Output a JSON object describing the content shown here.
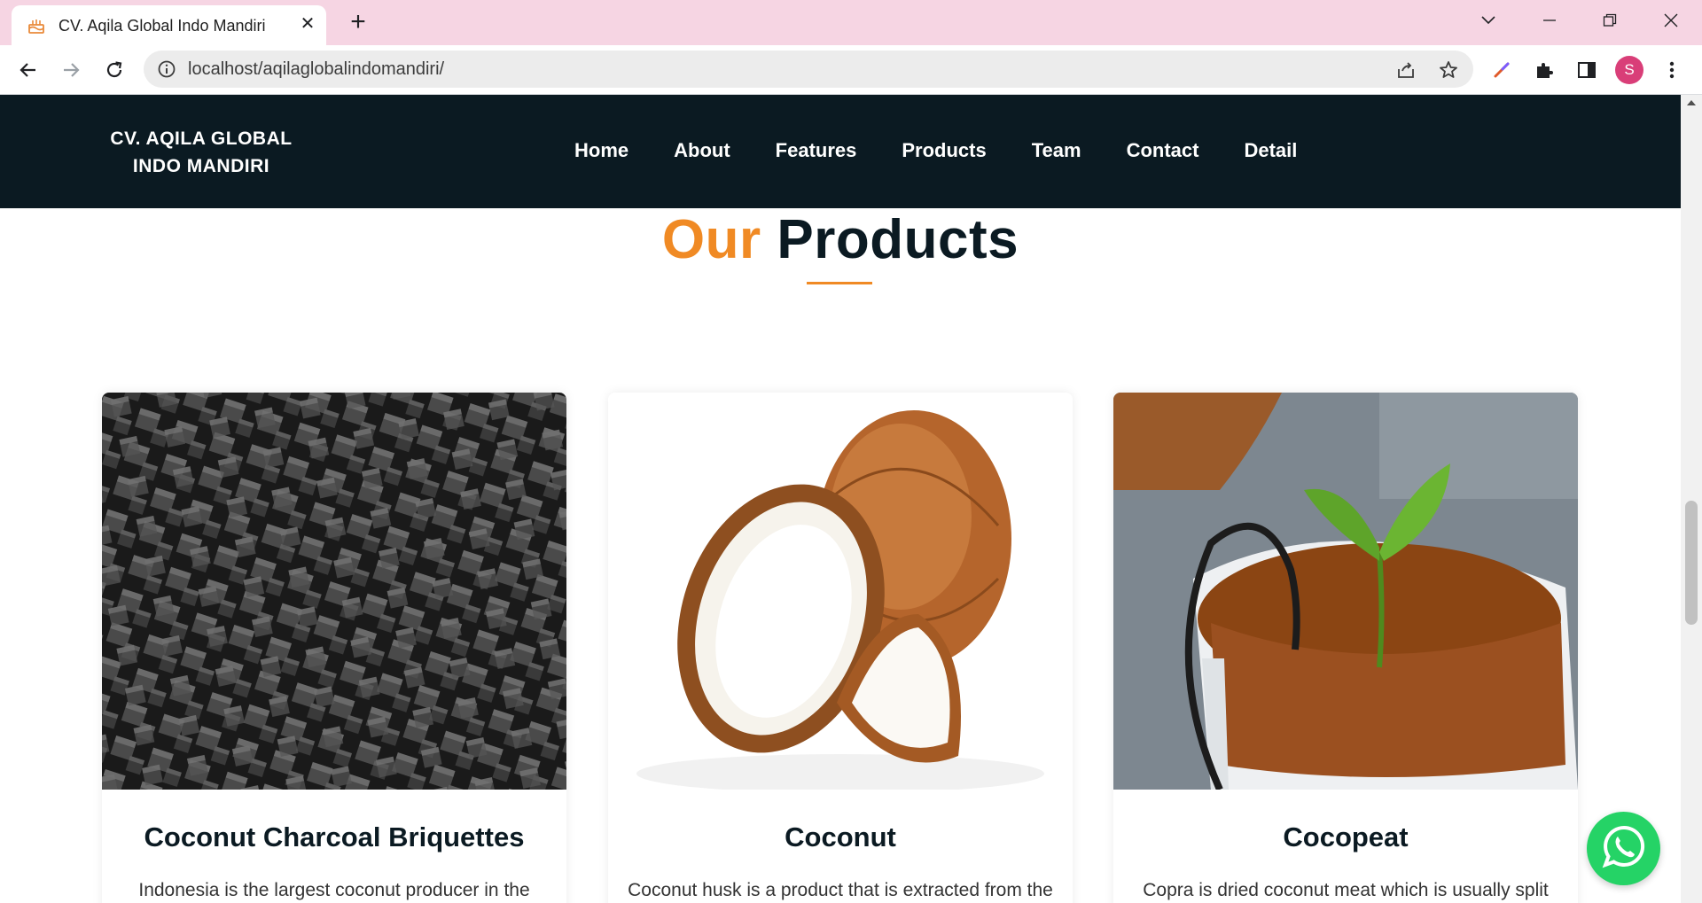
{
  "browser": {
    "tab_title": "CV. Aqila Global Indo Mandiri",
    "url": "localhost/aqilaglobalindomandiri/",
    "profile_initial": "S"
  },
  "site": {
    "logo_line1": "CV. AQILA GLOBAL",
    "logo_line2": "INDO MANDIRI",
    "menu": [
      "Home",
      "About",
      "Features",
      "Products",
      "Team",
      "Contact",
      "Detail"
    ]
  },
  "section": {
    "title_accent": "Our",
    "title_main": "Products"
  },
  "products": [
    {
      "title": "Coconut Charcoal Briquettes",
      "excerpt": "Indonesia is the largest coconut producer in the"
    },
    {
      "title": "Coconut",
      "excerpt": "Coconut husk is a product that is extracted from the"
    },
    {
      "title": "Cocopeat",
      "excerpt": "Copra is dried coconut meat which is usually split"
    }
  ],
  "colors": {
    "header_bg": "#0b1a22",
    "accent": "#f08a24",
    "whatsapp": "#25d366",
    "tab_strip": "#f6d5e3"
  }
}
